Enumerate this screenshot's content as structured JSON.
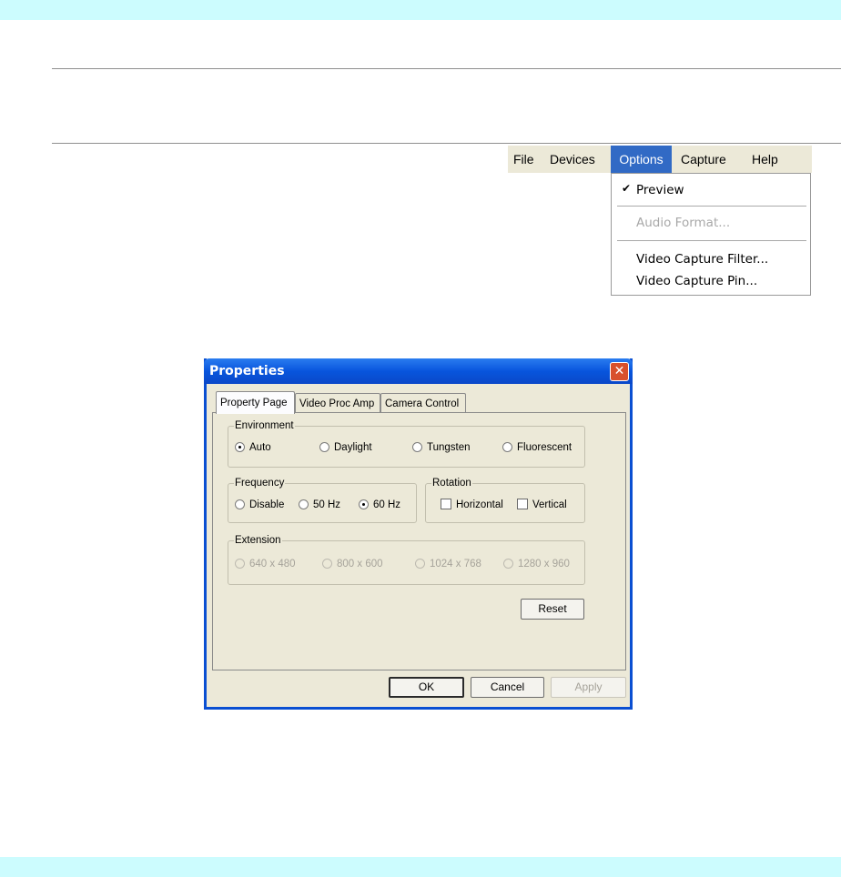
{
  "menu": {
    "bar": [
      "File",
      "Devices",
      "Options",
      "Capture",
      "Help"
    ],
    "active": "Options",
    "dropdown": {
      "items": [
        {
          "label": "Preview",
          "checked": true,
          "enabled": true
        },
        {
          "label": "Audio Format...",
          "checked": false,
          "enabled": false
        },
        {
          "label": "Video Capture Filter...",
          "checked": false,
          "enabled": true
        },
        {
          "label": "Video Capture Pin...",
          "checked": false,
          "enabled": true
        }
      ],
      "check_icon": "checkmark-icon"
    }
  },
  "dialog": {
    "title": "Properties",
    "close_icon": "close-icon",
    "tabs": [
      "Property Page",
      "Video Proc Amp",
      "Camera Control"
    ],
    "selected_tab": "Property Page",
    "environment": {
      "label": "Environment",
      "options": [
        "Auto",
        "Daylight",
        "Tungsten",
        "Fluorescent"
      ],
      "selected": "Auto"
    },
    "frequency": {
      "label": "Frequency",
      "options": [
        "Disable",
        "50 Hz",
        "60 Hz"
      ],
      "selected": "60 Hz"
    },
    "rotation": {
      "label": "Rotation",
      "options": [
        "Horizontal",
        "Vertical"
      ],
      "checked": []
    },
    "extension": {
      "label": "Extension",
      "options": [
        "640 x 480",
        "800 x 600",
        "1024 x 768",
        "1280 x 960"
      ],
      "enabled": false
    },
    "buttons": {
      "reset": "Reset",
      "ok": "OK",
      "cancel": "Cancel",
      "apply": "Apply"
    }
  },
  "colors": {
    "band": "#ccfcfe",
    "menu_highlight": "#316ac5",
    "titlebar": "#0855dd",
    "dialog_bg": "#ece9d8"
  }
}
